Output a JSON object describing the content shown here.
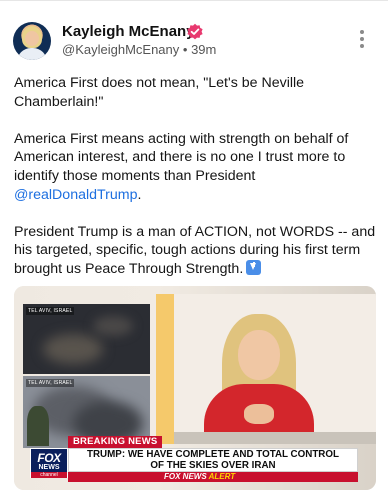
{
  "post": {
    "author_name": "Kayleigh McEnany",
    "handle": "@KayleighMcEnany",
    "separator": "•",
    "time": "39m",
    "paragraphs": {
      "p1": "America First does not mean, \"Let's be Neville Chamberlain!\"",
      "p2_before": "America First means acting with strength on behalf of American interest, and there is no one I trust more to identify those moments than President ",
      "p2_mention": "@realDonaldTrump",
      "p2_after": ".",
      "p3": "President Trump is a man of ACTION, not WORDS -- and his targeted, specific, tough actions during his first term brought us Peace Through Strength."
    },
    "emoji_name": "down-arrow-emoji"
  },
  "media": {
    "panel_top_label": "TEL AVIV, ISRAEL",
    "panel_bottom_label": "TEL AVIV, ISRAEL",
    "logo": {
      "fox": "FOX",
      "news": "NEWS",
      "channel": "channel"
    },
    "breaking_label": "BREAKING NEWS",
    "headline_line1": "TRUMP: WE HAVE COMPLETE AND TOTAL CONTROL",
    "headline_line2": "OF THE SKIES OVER IRAN",
    "alert_prefix": "FOX NEWS",
    "alert_suffix": "ALERT"
  },
  "colors": {
    "mention": "#1d6fe0",
    "verified_badge": "#e8396f",
    "breaking_red": "#c8102e",
    "fox_blue": "#0a1f5c"
  }
}
